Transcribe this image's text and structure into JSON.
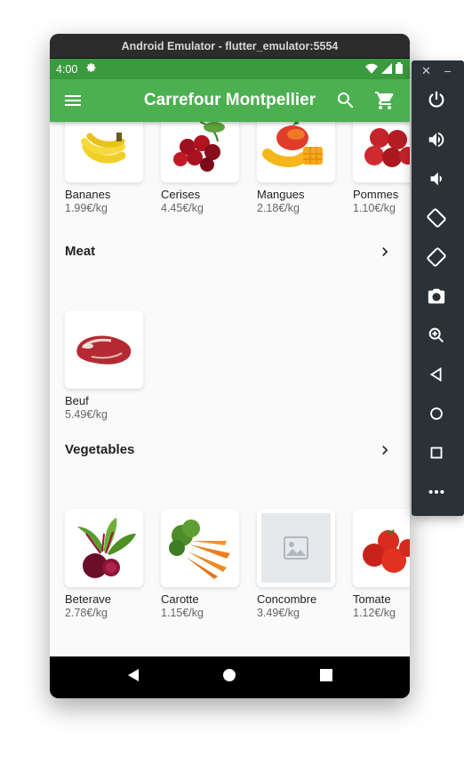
{
  "window": {
    "title": "Android Emulator - flutter_emulator:5554"
  },
  "statusbar": {
    "time": "4:00"
  },
  "appbar": {
    "title": "Carrefour Montpellier"
  },
  "sections": {
    "fruits": {
      "products": [
        {
          "name": "Bananes",
          "price": "1.99€/kg"
        },
        {
          "name": "Cerises",
          "price": "4.45€/kg"
        },
        {
          "name": "Mangues",
          "price": "2.18€/kg"
        },
        {
          "name": "Pommes",
          "price": "1.10€/kg"
        }
      ]
    },
    "meat": {
      "title": "Meat",
      "products": [
        {
          "name": "Beuf",
          "price": "5.49€/kg"
        }
      ]
    },
    "vegetables": {
      "title": "Vegetables",
      "products": [
        {
          "name": "Beterave",
          "price": "2.78€/kg"
        },
        {
          "name": "Carotte",
          "price": "1.15€/kg"
        },
        {
          "name": "Concombre",
          "price": "3.49€/kg"
        },
        {
          "name": "Tomate",
          "price": "1.12€/kg"
        }
      ]
    }
  },
  "icons": {
    "status": [
      "gear-icon",
      "wifi-icon",
      "signal-icon",
      "battery-icon"
    ],
    "appbar": [
      "menu-icon",
      "search-icon",
      "cart-icon"
    ],
    "navbar": [
      "back-icon",
      "home-icon",
      "recents-icon"
    ],
    "sidepanel": [
      "close-icon",
      "minimize-icon",
      "power-icon",
      "volume-up-icon",
      "volume-down-icon",
      "rotate-left-icon",
      "rotate-right-icon",
      "camera-icon",
      "zoom-icon",
      "back-icon",
      "home-icon",
      "overview-icon",
      "more-icon"
    ]
  },
  "colors": {
    "appbar": "#4caf50",
    "statusbar": "#3a9a3e",
    "background": "#fafafa"
  }
}
